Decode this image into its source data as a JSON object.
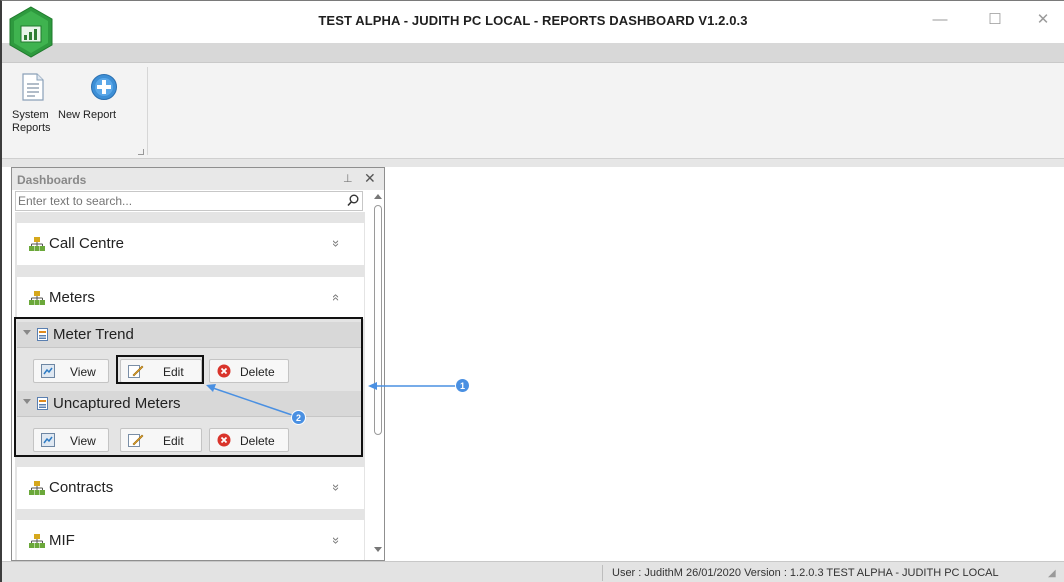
{
  "window": {
    "title": "TEST ALPHA - JUDITH PC LOCAL - REPORTS DASHBOARD V1.2.0.3",
    "minimize": "—",
    "maximize": "☐",
    "close": "✕"
  },
  "ribbon": {
    "system_reports_line1": "System",
    "system_reports_line2": "Reports",
    "new_report_label": "New Report"
  },
  "panel": {
    "title": "Dashboards",
    "pin": "⊥",
    "close": "✕",
    "search_placeholder": "Enter text to search..."
  },
  "groups": {
    "call_centre": {
      "label": "Call Centre",
      "chevron": "»"
    },
    "meters": {
      "label": "Meters",
      "chevron": "«"
    },
    "contracts": {
      "label": "Contracts",
      "chevron": "»"
    },
    "mif": {
      "label": "MIF",
      "chevron": "»"
    }
  },
  "reports": [
    {
      "label": "Meter Trend",
      "view": "View",
      "edit": "Edit",
      "delete": "Delete"
    },
    {
      "label": "Uncaptured Meters",
      "view": "View",
      "edit": "Edit",
      "delete": "Delete"
    }
  ],
  "annotations": {
    "badge1": "1",
    "badge2": "2",
    "color": "#4a90e2"
  },
  "status": {
    "text": "User : JudithM   26/01/2020   Version : 1.2.0.3   TEST ALPHA - JUDITH PC LOCAL"
  },
  "colors": {
    "accent": "#4a90e2",
    "logo_green": "#2e9a3e",
    "delete_red": "#d9342b"
  }
}
